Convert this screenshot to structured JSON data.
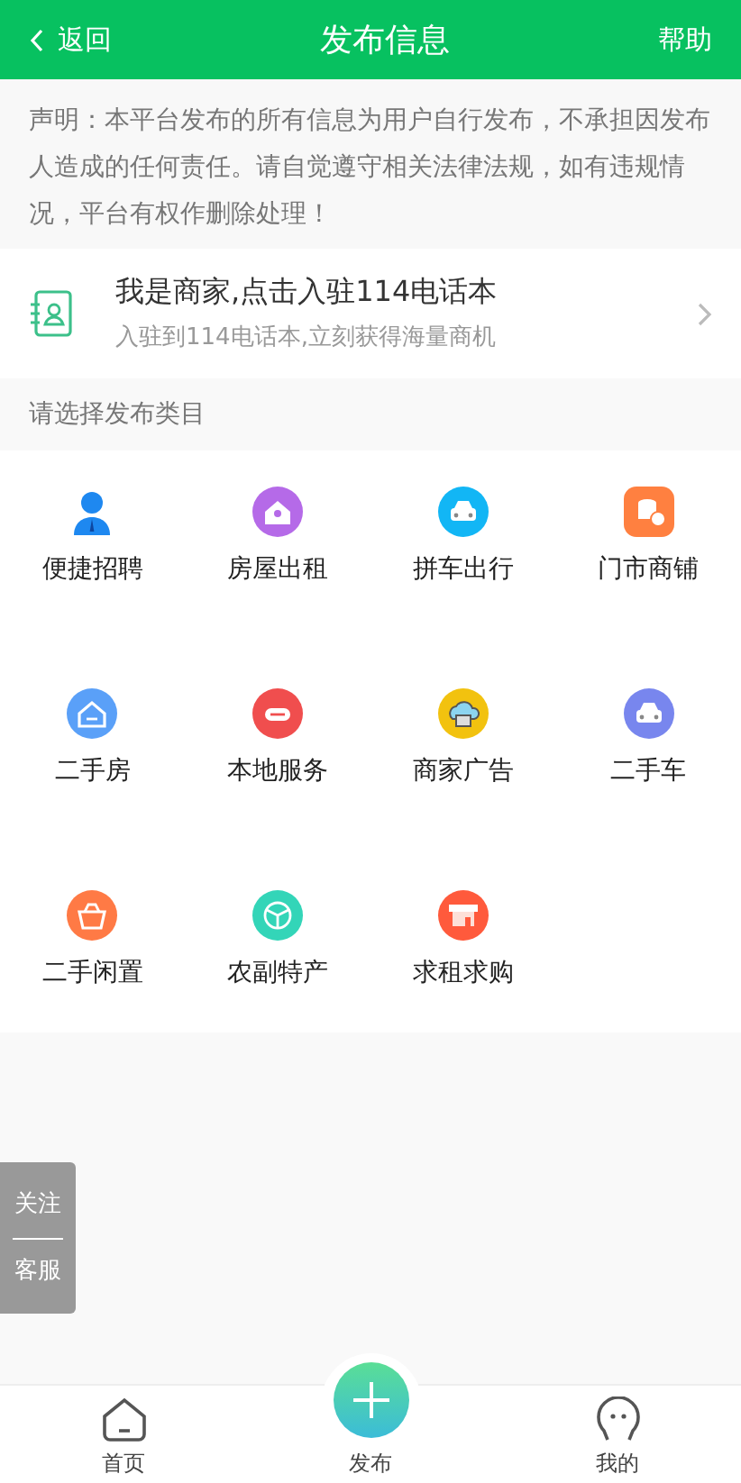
{
  "header": {
    "back": "返回",
    "title": "发布信息",
    "help": "帮助"
  },
  "notice": "声明：本平台发布的所有信息为用户自行发布，不承担因发布人造成的任何责任。请自觉遵守相关法律法规，如有违规情况，平台有权作删除处理！",
  "merchant": {
    "title": "我是商家,点击入驻114电话本",
    "subtitle": "入驻到114电话本,立刻获得海量商机"
  },
  "section_label": "请选择发布类目",
  "categories": [
    {
      "label": "便捷招聘",
      "kind": "person",
      "color": "#1e88f0"
    },
    {
      "label": "房屋出租",
      "kind": "house-key",
      "color": "#b56ae8"
    },
    {
      "label": "拼车出行",
      "kind": "car",
      "color": "#12b6f5"
    },
    {
      "label": "门市商铺",
      "kind": "coins",
      "color": "#ff8040"
    },
    {
      "label": "二手房",
      "kind": "house",
      "color": "#5aa0f8"
    },
    {
      "label": "本地服务",
      "kind": "hot",
      "color": "#f04e4e"
    },
    {
      "label": "商家广告",
      "kind": "cloud",
      "color": "#f2c20f"
    },
    {
      "label": "二手车",
      "kind": "car",
      "color": "#7886ee"
    },
    {
      "label": "二手闲置",
      "kind": "basket",
      "color": "#ff7a45"
    },
    {
      "label": "农副特产",
      "kind": "box",
      "color": "#33d5b8"
    },
    {
      "label": "求租求购",
      "kind": "shop",
      "color": "#ff5a3c"
    }
  ],
  "float_menu": [
    "关注",
    "客服"
  ],
  "tabs": [
    {
      "label": "首页",
      "kind": "home"
    },
    {
      "label": "发布",
      "kind": "publish"
    },
    {
      "label": "我的",
      "kind": "me"
    }
  ]
}
